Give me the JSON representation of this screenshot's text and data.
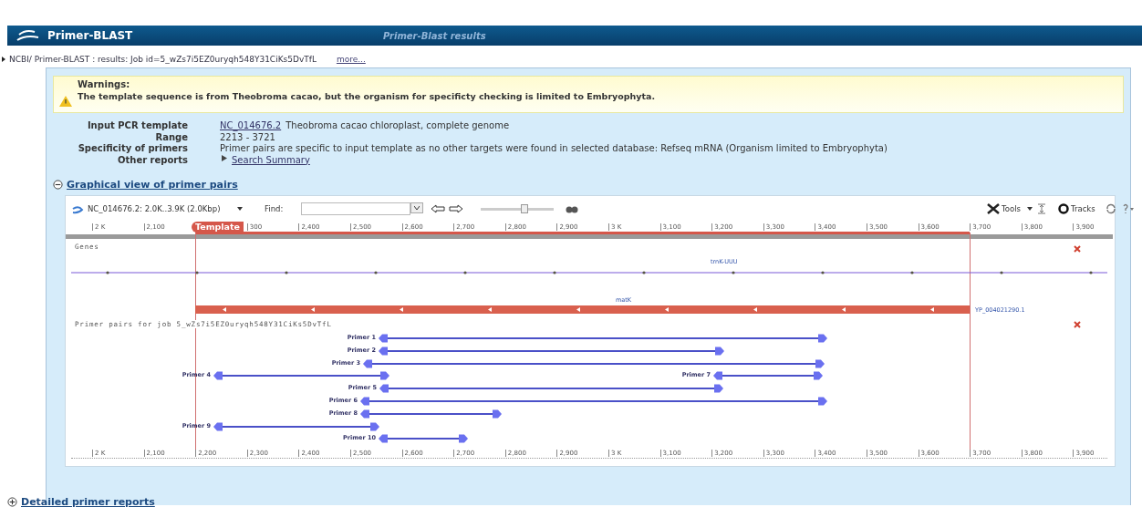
{
  "header": {
    "title": "Primer-BLAST",
    "subtitle": "Primer-Blast results"
  },
  "breadcrumb": {
    "text": "NCBI/ Primer-BLAST : results: Job id=5_wZs7i5EZ0uryqh548Y31CiKs5DvTfL",
    "more": "more..."
  },
  "warning": {
    "title": "Warnings:",
    "text": "The template sequence is from Theobroma cacao, but the organism for specificty checking is limited to Embryophyta."
  },
  "info": [
    {
      "label": "Input PCR template",
      "link": "NC_014676.2",
      "value": "Theobroma cacao chloroplast, complete genome"
    },
    {
      "label": "Range",
      "value": "2213 - 3721"
    },
    {
      "label": "Specificity of primers",
      "value": "Primer pairs are specific to input template as no other targets were found in selected database: Refseq mRNA (Organism limited to Embryophyta)"
    },
    {
      "label": "Other reports",
      "link": "Search Summary",
      "kind": "arrow-link"
    }
  ],
  "sections": [
    {
      "title": "Graphical view of primer pairs",
      "expanded": true
    },
    {
      "title": "Detailed primer reports",
      "expanded": false
    }
  ],
  "viewer": {
    "sequence_menu": "NC_014676.2: 2.0K..3.9K (2.0Kbp)",
    "find_label": "Find:",
    "tools": "Tools",
    "tracks": "Tracks",
    "zoom": {
      "level": 0.6
    },
    "top_ticks": [
      "2 K",
      "2,100",
      "300",
      "2,400",
      "2,500",
      "2,600",
      "2,700",
      "2,800",
      "2,900",
      "3 K",
      "3,100",
      "3,200",
      "3,300",
      "3,400",
      "3,500",
      "3,600",
      "3,700",
      "3,800",
      "3,900"
    ],
    "template_label": "Template",
    "bottom_ticks": [
      "2 K",
      "2,100",
      "2,200",
      "2,300",
      "2,400",
      "2,500",
      "2,600",
      "2,700",
      "2,800",
      "2,900",
      "3 K",
      "3,100",
      "3,200",
      "3,300",
      "3,400",
      "3,500",
      "3,600",
      "3,700",
      "3,800",
      "3,900"
    ],
    "genes_track": {
      "title": "Genes",
      "gene_label": "trnK-UUU",
      "feature_label": "matK",
      "feature_id": "YP_004021290.1"
    },
    "primer_track": {
      "title": "Primer pairs for job 5_wZs7i5EZ0uryqh548Y31CiKs5DvTfL"
    },
    "primer_rows": [
      [
        {
          "label": "Primer 1"
        }
      ],
      [
        {
          "label": "Primer 2"
        }
      ],
      [
        {
          "label": "Primer 3"
        }
      ],
      [
        {
          "label": "Primer 4"
        },
        {
          "label": "Primer 7"
        }
      ],
      [
        {
          "label": "Primer 5"
        }
      ],
      [
        {
          "label": "Primer 6"
        }
      ],
      [
        {
          "label": "Primer 8"
        }
      ],
      [
        {
          "label": "Primer 9"
        }
      ],
      [
        {
          "label": "Primer 10"
        }
      ]
    ]
  }
}
